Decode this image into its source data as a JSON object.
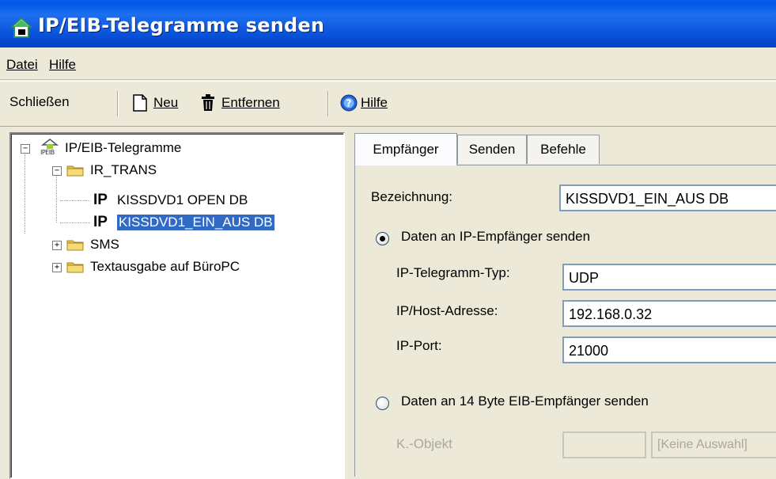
{
  "window": {
    "title": "IP/EIB-Telegramme senden",
    "icon": "home-icon"
  },
  "menu": {
    "items": [
      {
        "label": "Datei"
      },
      {
        "label": "Hilfe"
      }
    ]
  },
  "toolbar": {
    "close_label": "Schließen",
    "new_label": "Neu",
    "remove_label": "Entfernen",
    "help_label": "Hilfe"
  },
  "tree": {
    "root_label": "IP/EIB-Telegramme",
    "root_icon_text": "IPEIB",
    "groups": [
      {
        "label": "IR_TRANS",
        "expanded": true,
        "items": [
          {
            "tag": "IP",
            "label": "KISSDVD1 OPEN DB",
            "selected": false
          },
          {
            "tag": "IP",
            "label": "KISSDVD1_EIN_AUS DB",
            "selected": true
          }
        ]
      },
      {
        "label": "SMS",
        "expanded": false
      },
      {
        "label": "Textausgabe auf BüroPC",
        "expanded": false
      }
    ]
  },
  "tabs": [
    {
      "label": "Empfänger",
      "active": true
    },
    {
      "label": "Senden",
      "active": false
    },
    {
      "label": "Befehle",
      "active": false
    }
  ],
  "form": {
    "name_label": "Bezeichnung:",
    "name_value": "KISSDVD1_EIN_AUS DB",
    "radio_ip_label": "Daten an IP-Empfänger senden",
    "radio_ip_checked": true,
    "ip_type_label": "IP-Telegramm-Typ:",
    "ip_type_value": "UDP",
    "ip_host_label": "IP/Host-Adresse:",
    "ip_host_value": "192.168.0.32",
    "ip_port_label": "IP-Port:",
    "ip_port_value": "21000",
    "radio_eib_label": "Daten an 14 Byte EIB-Empfänger senden",
    "radio_eib_checked": false,
    "kobj_label": "K.-Objekt",
    "kobj_value": "",
    "kobj_selection": "[Keine Auswahl]"
  },
  "colors": {
    "titlebar": "#0A54DC",
    "selection": "#316AC5",
    "face": "#ECE9D8"
  }
}
